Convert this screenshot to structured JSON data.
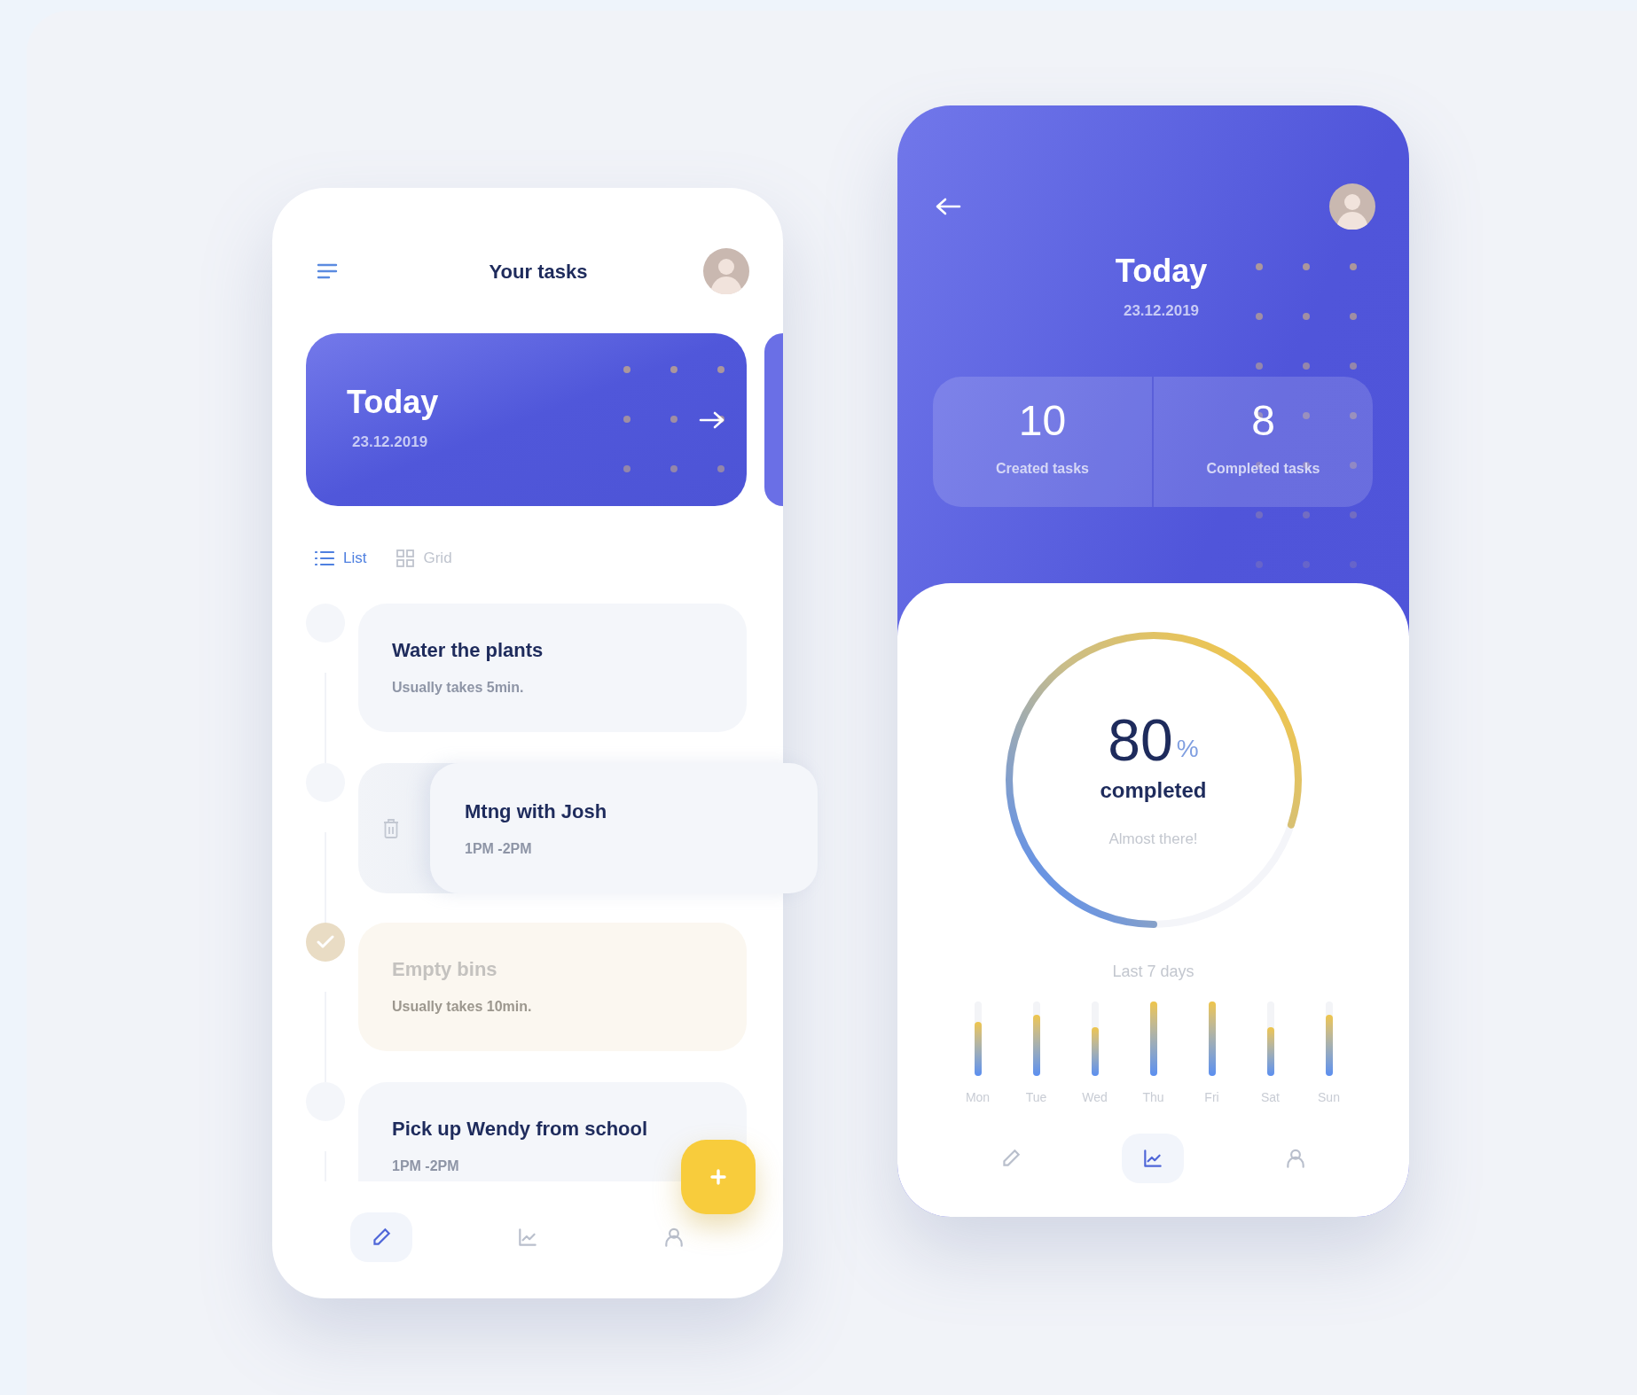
{
  "tasks_screen": {
    "title": "Your tasks",
    "today_card": {
      "title": "Today",
      "date": "23.12.2019"
    },
    "view_tabs": [
      {
        "label": "List",
        "kind": "list",
        "selected": true
      },
      {
        "label": "Grid",
        "kind": "grid",
        "selected": false
      }
    ],
    "tasks": [
      {
        "kind": "normal",
        "title": "Water the plants",
        "detail": "Usually takes 5min.",
        "done": false
      },
      {
        "kind": "swiped",
        "title": "Mtng with Josh",
        "detail": "1PM -2PM",
        "done": false
      },
      {
        "kind": "normal",
        "title": "Empty bins",
        "detail": "Usually takes 10min.",
        "done": true
      },
      {
        "kind": "normal",
        "title": "Pick up Wendy from school",
        "detail": "1PM -2PM",
        "done": false
      }
    ],
    "nav": [
      {
        "kind": "edit",
        "selected": true
      },
      {
        "kind": "stats",
        "selected": false
      },
      {
        "kind": "profile",
        "selected": false
      }
    ]
  },
  "stats_screen": {
    "title": "Today",
    "date": "23.12.2019",
    "stats": [
      {
        "value": "10",
        "label": "Created tasks"
      },
      {
        "value": "8",
        "label": "Completed tasks"
      }
    ],
    "progress": {
      "level": 0.8,
      "value": "80",
      "unit": "%",
      "label": "completed",
      "note": "Almost there!"
    },
    "week": {
      "title": "Last 7 days",
      "days": [
        {
          "label": "Mon",
          "level": 0.73
        },
        {
          "label": "Tue",
          "level": 0.82
        },
        {
          "label": "Wed",
          "level": 0.66
        },
        {
          "label": "Thu",
          "level": 1
        },
        {
          "label": "Fri",
          "level": 1
        },
        {
          "label": "Sat",
          "level": 0.66
        },
        {
          "label": "Sun",
          "level": 0.82
        }
      ]
    },
    "nav": [
      {
        "kind": "edit",
        "selected": false
      },
      {
        "kind": "stats",
        "selected": true
      },
      {
        "kind": "profile",
        "selected": false
      }
    ]
  }
}
